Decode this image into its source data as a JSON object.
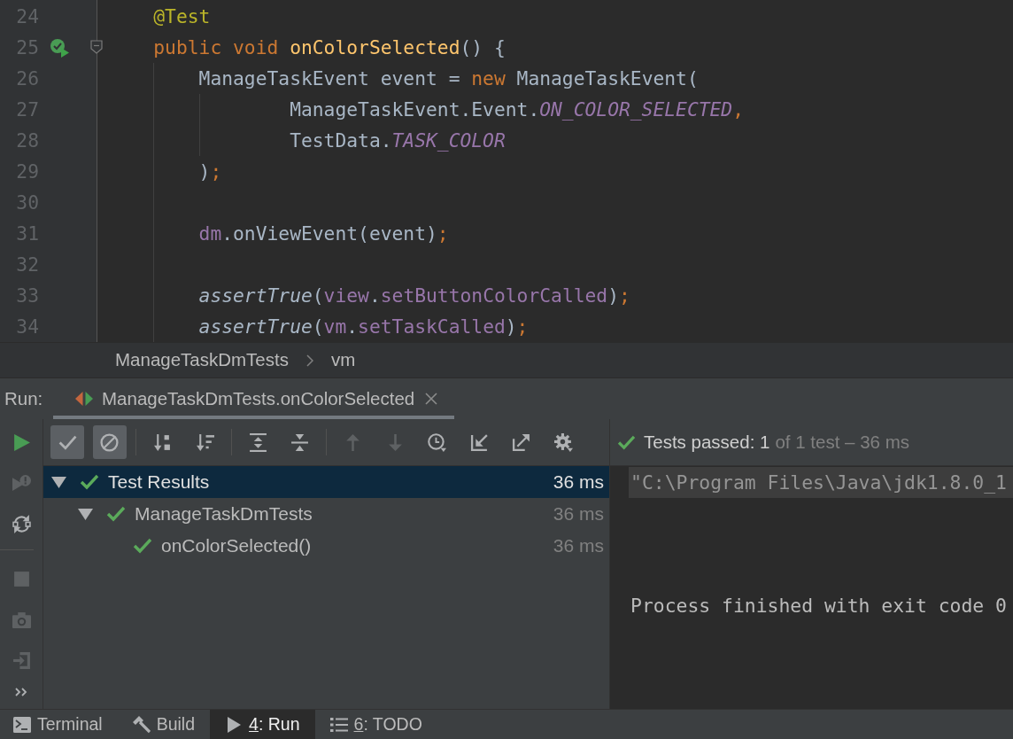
{
  "editor": {
    "lines": [
      {
        "number": "24",
        "run_marker": false,
        "fold_marker": false,
        "tokens": [
          {
            "text": "    @Test",
            "kind": "annotation"
          }
        ]
      },
      {
        "number": "25",
        "run_marker": true,
        "fold_marker": true,
        "tokens": [
          {
            "text": "    public void ",
            "kind": "keyword"
          },
          {
            "text": "onColorSelected",
            "kind": "method"
          },
          {
            "text": "() {",
            "kind": "plain"
          }
        ]
      },
      {
        "number": "26",
        "run_marker": false,
        "fold_marker": false,
        "tokens": [
          {
            "text": "        ManageTaskEvent event = ",
            "kind": "plain"
          },
          {
            "text": "new",
            "kind": "keyword"
          },
          {
            "text": " ManageTaskEvent(",
            "kind": "plain"
          }
        ]
      },
      {
        "number": "27",
        "run_marker": false,
        "fold_marker": false,
        "tokens": [
          {
            "text": "                ManageTaskEvent.Event.",
            "kind": "plain"
          },
          {
            "text": "ON_COLOR_SELECTED",
            "kind": "constant"
          },
          {
            "text": ",",
            "kind": "punct"
          }
        ]
      },
      {
        "number": "28",
        "run_marker": false,
        "fold_marker": false,
        "tokens": [
          {
            "text": "                TestData.",
            "kind": "plain"
          },
          {
            "text": "TASK_COLOR",
            "kind": "constant"
          }
        ]
      },
      {
        "number": "29",
        "run_marker": false,
        "fold_marker": false,
        "tokens": [
          {
            "text": "        )",
            "kind": "plain"
          },
          {
            "text": ";",
            "kind": "punct"
          }
        ]
      },
      {
        "number": "30",
        "run_marker": false,
        "fold_marker": false
      },
      {
        "number": "31",
        "run_marker": false,
        "fold_marker": false,
        "tokens": [
          {
            "text": "        dm",
            "kind": "field"
          },
          {
            "text": ".onViewEvent(event)",
            "kind": "plain"
          },
          {
            "text": ";",
            "kind": "punct"
          }
        ]
      },
      {
        "number": "32",
        "run_marker": false,
        "fold_marker": false
      },
      {
        "number": "33",
        "run_marker": false,
        "fold_marker": false,
        "tokens": [
          {
            "text": "        assertTrue",
            "kind": "static"
          },
          {
            "text": "(",
            "kind": "plain"
          },
          {
            "text": "view",
            "kind": "field"
          },
          {
            "text": ".",
            "kind": "plain"
          },
          {
            "text": "setButtonColorCalled",
            "kind": "field"
          },
          {
            "text": ")",
            "kind": "plain"
          },
          {
            "text": ";",
            "kind": "punct"
          }
        ]
      },
      {
        "number": "34",
        "run_marker": false,
        "fold_marker": false,
        "tokens": [
          {
            "text": "        assertTrue",
            "kind": "static"
          },
          {
            "text": "(",
            "kind": "plain"
          },
          {
            "text": "vm",
            "kind": "field"
          },
          {
            "text": ".",
            "kind": "plain"
          },
          {
            "text": "setTaskCalled",
            "kind": "field"
          },
          {
            "text": ")",
            "kind": "plain"
          },
          {
            "text": ";",
            "kind": "punct"
          }
        ]
      }
    ]
  },
  "breadcrumbs": [
    {
      "label": "ManageTaskDmTests"
    },
    {
      "label": "vm"
    }
  ],
  "run": {
    "title": "Run:",
    "tabs": [
      {
        "label": "ManageTaskDmTests.onColorSelected",
        "selected": true
      }
    ]
  },
  "side_toolbar": {
    "groups": [
      [
        {
          "disabled": false
        },
        {
          "disabled": true
        },
        {
          "disabled": false
        }
      ],
      [
        {
          "disabled": true
        },
        {
          "disabled": true
        },
        {
          "disabled": true
        }
      ]
    ]
  },
  "test_toolbar": {
    "groups": [
      [
        {
          "kind": "toggle",
          "on": true
        },
        {
          "kind": "toggle",
          "on": true
        }
      ],
      [
        {
          "kind": "button",
          "disabled": false
        },
        {
          "kind": "button",
          "disabled": false
        }
      ],
      [
        {
          "kind": "button",
          "disabled": false
        },
        {
          "kind": "button",
          "disabled": false
        }
      ],
      [
        {
          "kind": "button",
          "disabled": true
        },
        {
          "kind": "button",
          "disabled": true
        },
        {
          "kind": "button",
          "disabled": false
        },
        {
          "kind": "button",
          "disabled": false
        },
        {
          "kind": "button",
          "disabled": false
        },
        {
          "kind": "button",
          "disabled": false
        }
      ]
    ]
  },
  "status": {
    "summary": "Tests passed: 1",
    "detail": "of 1 test – 36 ms"
  },
  "tree": [
    {
      "label": "Test Results",
      "time": "36 ms",
      "selected": true,
      "expanded": true,
      "children": [
        {
          "label": "ManageTaskDmTests",
          "time": "36 ms",
          "selected": false,
          "expanded": true,
          "children": [
            {
              "label": "onColorSelected()",
              "time": "36 ms",
              "selected": false
            }
          ]
        }
      ]
    }
  ],
  "console": {
    "lines": [
      {
        "text": "\"C:\\Program Files\\Java\\jdk1.8.0_1",
        "kind": "command",
        "highlighted": true
      },
      {
        "text": "Process finished with exit code 0",
        "kind": "exit",
        "highlighted": false
      }
    ]
  },
  "tool_window_bar": {
    "items": [
      {
        "label": "Terminal",
        "selected": false
      },
      {
        "label": "Build",
        "selected": false
      },
      {
        "mnemonic": "4",
        "label": ": Run",
        "selected": true
      },
      {
        "mnemonic": "6",
        "label": ": TODO",
        "selected": false
      }
    ]
  }
}
